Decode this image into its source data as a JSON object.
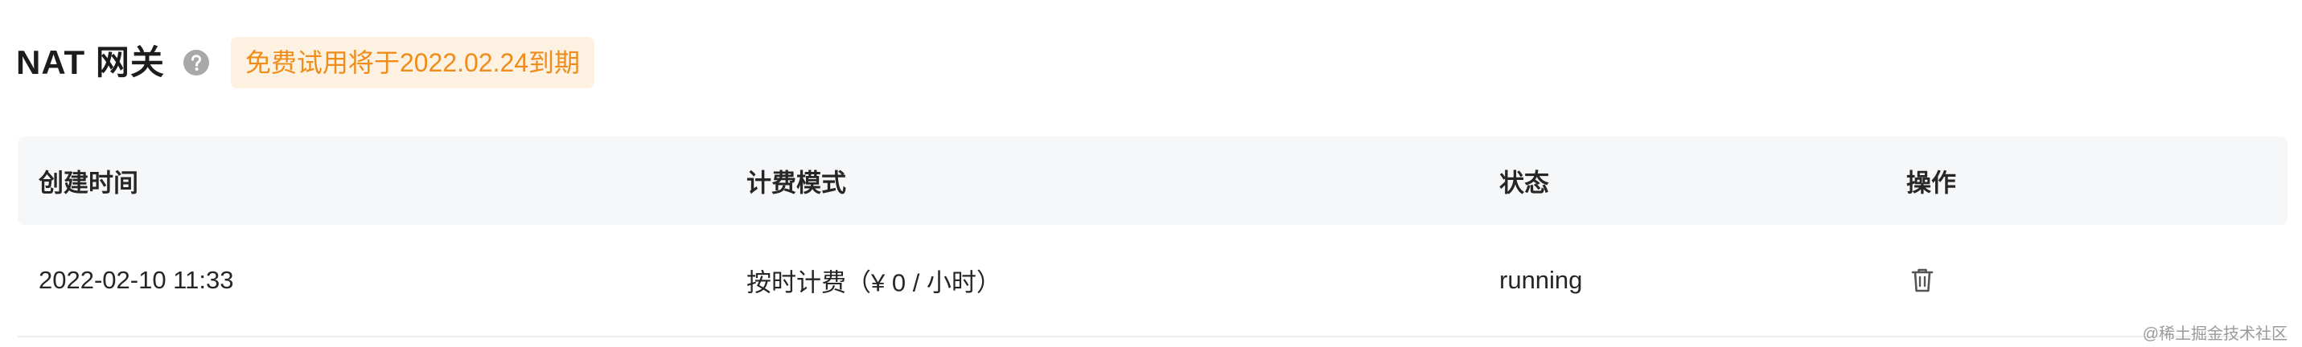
{
  "header": {
    "title": "NAT 网关",
    "help_icon": "question-circle-icon",
    "badge_text": "免费试用将于2022.02.24到期",
    "badge_color": "#f08c1a"
  },
  "table": {
    "columns": [
      "创建时间",
      "计费模式",
      "状态",
      "操作"
    ],
    "rows": [
      {
        "created": "2022-02-10 11:33",
        "billing": "按时计费（¥ 0 / 小时）",
        "status": "running",
        "action_icon": "trash-icon"
      }
    ]
  },
  "watermark": "@稀土掘金技术社区"
}
